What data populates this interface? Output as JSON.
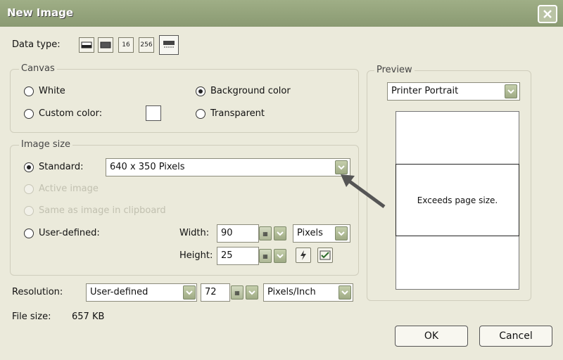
{
  "window": {
    "title": "New Image"
  },
  "toolbar": {
    "data_type_label": "Data type:",
    "types": [
      {
        "label": "",
        "icon": "mono-icon"
      },
      {
        "label": "",
        "icon": "gray-icon"
      },
      {
        "label": "16",
        "icon": "16-color-icon"
      },
      {
        "label": "256",
        "icon": "256-color-icon"
      },
      {
        "label": "",
        "icon": "true-color-icon",
        "selected": true
      }
    ]
  },
  "canvas": {
    "title": "Canvas",
    "options": {
      "white": "White",
      "custom": "Custom color:",
      "background": "Background color",
      "transparent": "Transparent"
    },
    "selected": "background"
  },
  "image_size": {
    "title": "Image size",
    "standard_label": "Standard:",
    "standard_value": "640 x 350 Pixels",
    "active_image_label": "Active image",
    "clipboard_label": "Same as image in clipboard",
    "user_defined_label": "User-defined:",
    "width_label": "Width:",
    "width_value": "90",
    "height_label": "Height:",
    "height_value": "25",
    "units_value": "Pixels",
    "selected": "standard"
  },
  "resolution": {
    "label": "Resolution:",
    "mode_value": "User-defined",
    "value": "72",
    "units_value": "Pixels/Inch"
  },
  "file_size": {
    "label": "File size:",
    "value": "657 KB"
  },
  "preview": {
    "title": "Preview",
    "select_value": "Printer Portrait",
    "message": "Exceeds page size."
  },
  "buttons": {
    "ok": "OK",
    "cancel": "Cancel"
  },
  "colors": {
    "titlebar": "#9fae86",
    "dialog_bg": "#ebeadb",
    "dropdown_button": "#b4bf9a"
  }
}
